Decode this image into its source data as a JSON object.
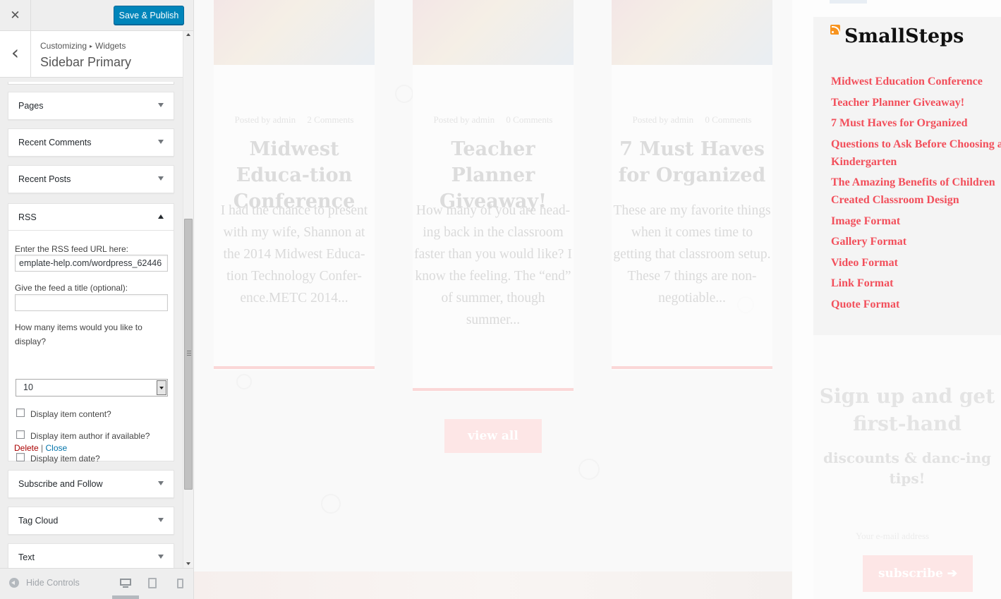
{
  "customizer": {
    "close_glyph": "✕",
    "save_label": "Save & Publish",
    "back_glyph": "‹",
    "breadcrumb": {
      "root": "Customizing",
      "separator": "▸",
      "parent": "Widgets"
    },
    "section_title": "Sidebar Primary",
    "widgets_above": [
      {
        "label": "Pages"
      },
      {
        "label": "Recent Comments"
      },
      {
        "label": "Recent Posts"
      }
    ],
    "rss": {
      "label": "RSS",
      "url_label": "Enter the RSS feed URL here:",
      "url_value": "emplate-help.com/wordpress_62446",
      "title_label": "Give the feed a title (optional):",
      "title_value": "",
      "items_label": "How many items would you like to display?",
      "items_value": "10",
      "checkboxes": [
        {
          "label": "Display item content?",
          "checked": false
        },
        {
          "label": "Display item author if available?",
          "checked": false
        },
        {
          "label": "Display item date?",
          "checked": false
        }
      ],
      "delete_label": "Delete",
      "action_separator": "|",
      "close_label": "Close"
    },
    "widgets_below": [
      {
        "label": "Subscribe and Follow"
      },
      {
        "label": "Tag Cloud"
      },
      {
        "label": "Text"
      }
    ],
    "footer": {
      "hide_label": "Hide Controls",
      "devices": [
        "desktop-icon",
        "tablet-icon",
        "mobile-icon"
      ]
    },
    "colors": {
      "primary_button": "#0085ba",
      "delete_link": "#a00",
      "close_link": "#0073aa"
    }
  },
  "preview": {
    "posts": [
      {
        "meta_author": "Posted by admin",
        "meta_comments": "2 Comments",
        "title": "Midwest Educa-tion Conference",
        "excerpt": "I had the chance to present with my wife, Shannon at the 2014 Midwest Educa-tion Technology Confer-ence.METC 2014..."
      },
      {
        "meta_author": "Posted by admin",
        "meta_comments": "0 Comments",
        "title": "Teacher Planner Giveaway!",
        "excerpt": "How many of you are head-ing back in the classroom faster than you would like? I know the feeling. The “end” of summer, though summer..."
      },
      {
        "meta_author": "Posted by admin",
        "meta_comments": "0 Comments",
        "title": "7 Must Haves for Organized",
        "excerpt": "These are my favorite things when it comes time to getting that classroom setup. These 7 things are non-negotiable..."
      }
    ],
    "view_all_label": "view all",
    "rss_widget": {
      "title": "SmallSteps",
      "links": [
        "Midwest Education Conference",
        "Teacher Planner Giveaway!",
        "7 Must Haves for Organized",
        "Questions to Ask Before Choosing a Kindergarten",
        "The Amazing Benefits of Children Created Classroom Design",
        "Image Format",
        "Gallery Format",
        "Video Format",
        "Link Format",
        "Quote Format"
      ]
    },
    "signup": {
      "title": "Sign up and get first-hand",
      "subtitle": "discounts & danc-ing tips!",
      "email_placeholder": "Your e-mail address",
      "button_label": "subscribe ➔"
    },
    "colors": {
      "link": "#f24f5b",
      "accent_pink": "#fbd7d7"
    }
  }
}
